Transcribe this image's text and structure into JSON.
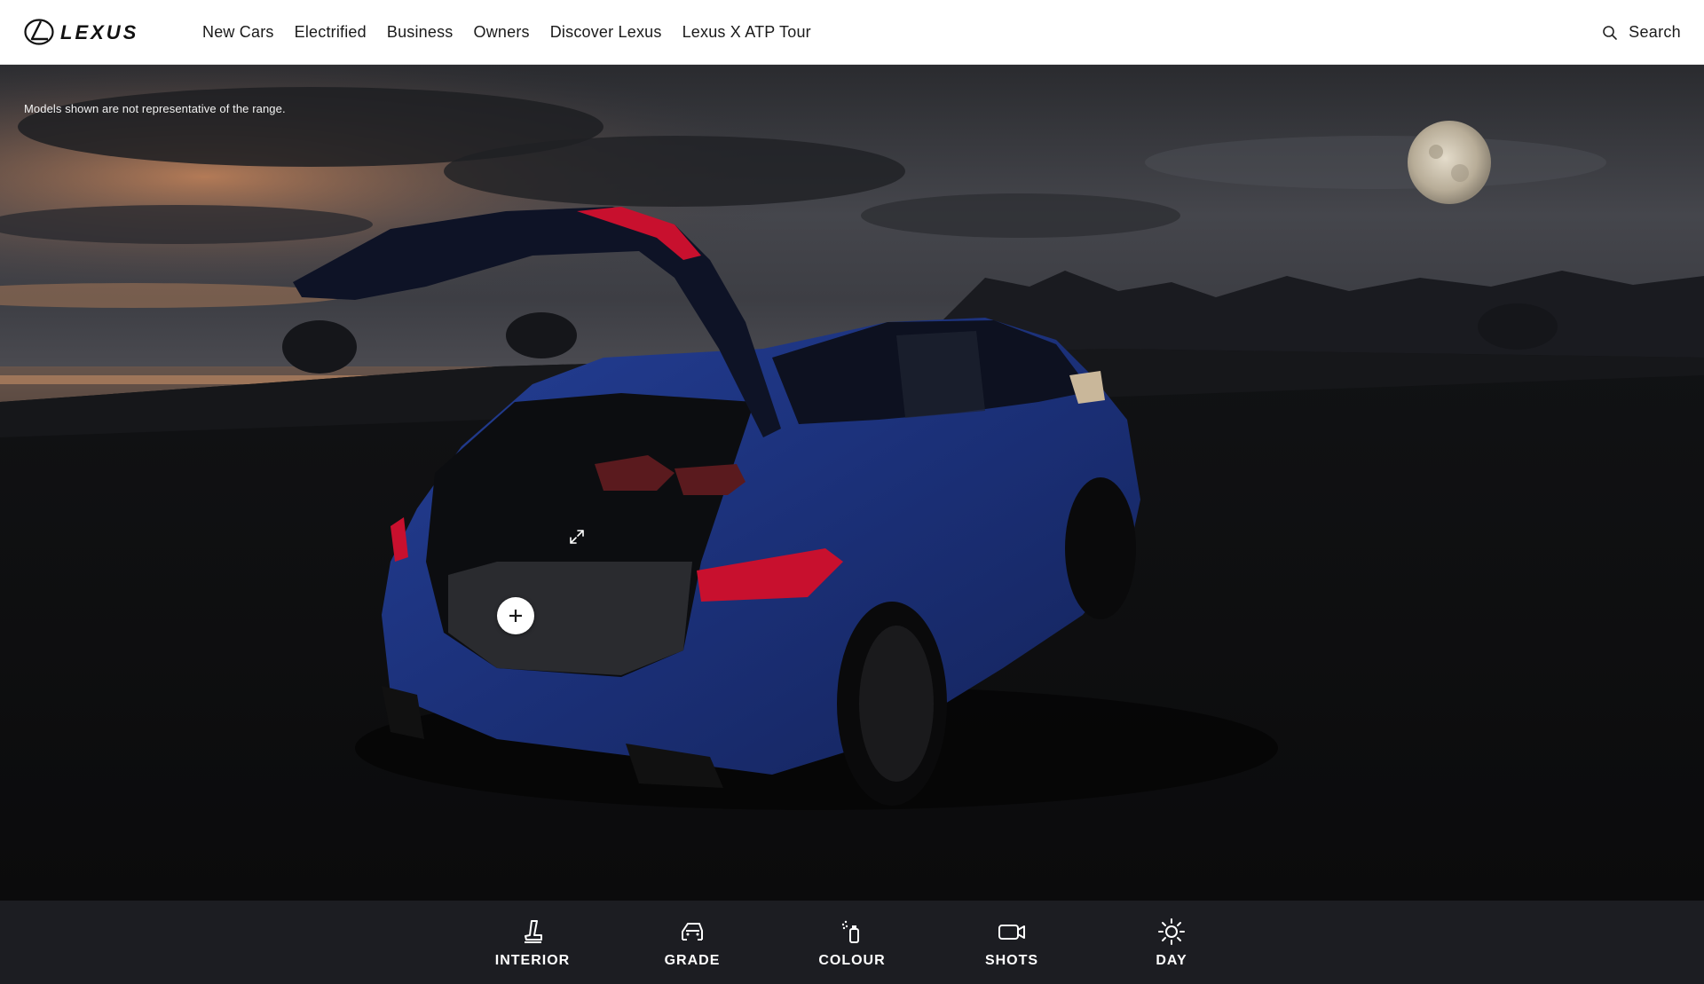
{
  "brand": {
    "name": "LEXUS",
    "logo_icon": "lexus-logo-icon"
  },
  "nav": {
    "items": [
      {
        "label": "New Cars"
      },
      {
        "label": "Electrified"
      },
      {
        "label": "Business"
      },
      {
        "label": "Owners"
      },
      {
        "label": "Discover Lexus"
      },
      {
        "label": "Lexus X ATP Tour"
      }
    ]
  },
  "search": {
    "label": "Search",
    "icon": "search-icon"
  },
  "scene": {
    "disclaimer": "Models shown are not representative of the range.",
    "hotspot_icon": "plus-icon",
    "expand_icon": "expand-icon",
    "vehicle_color": "#1f3a8a"
  },
  "toolbar": {
    "items": [
      {
        "label": "INTERIOR",
        "icon": "seat-icon"
      },
      {
        "label": "GRADE",
        "icon": "car-icon"
      },
      {
        "label": "COLOUR",
        "icon": "spray-can-icon"
      },
      {
        "label": "SHOTS",
        "icon": "video-camera-icon"
      },
      {
        "label": "DAY",
        "icon": "sun-icon"
      }
    ]
  },
  "colors": {
    "header_bg": "#ffffff",
    "toolbar_bg": "#1c1d22",
    "accent_red": "#c8102e"
  }
}
